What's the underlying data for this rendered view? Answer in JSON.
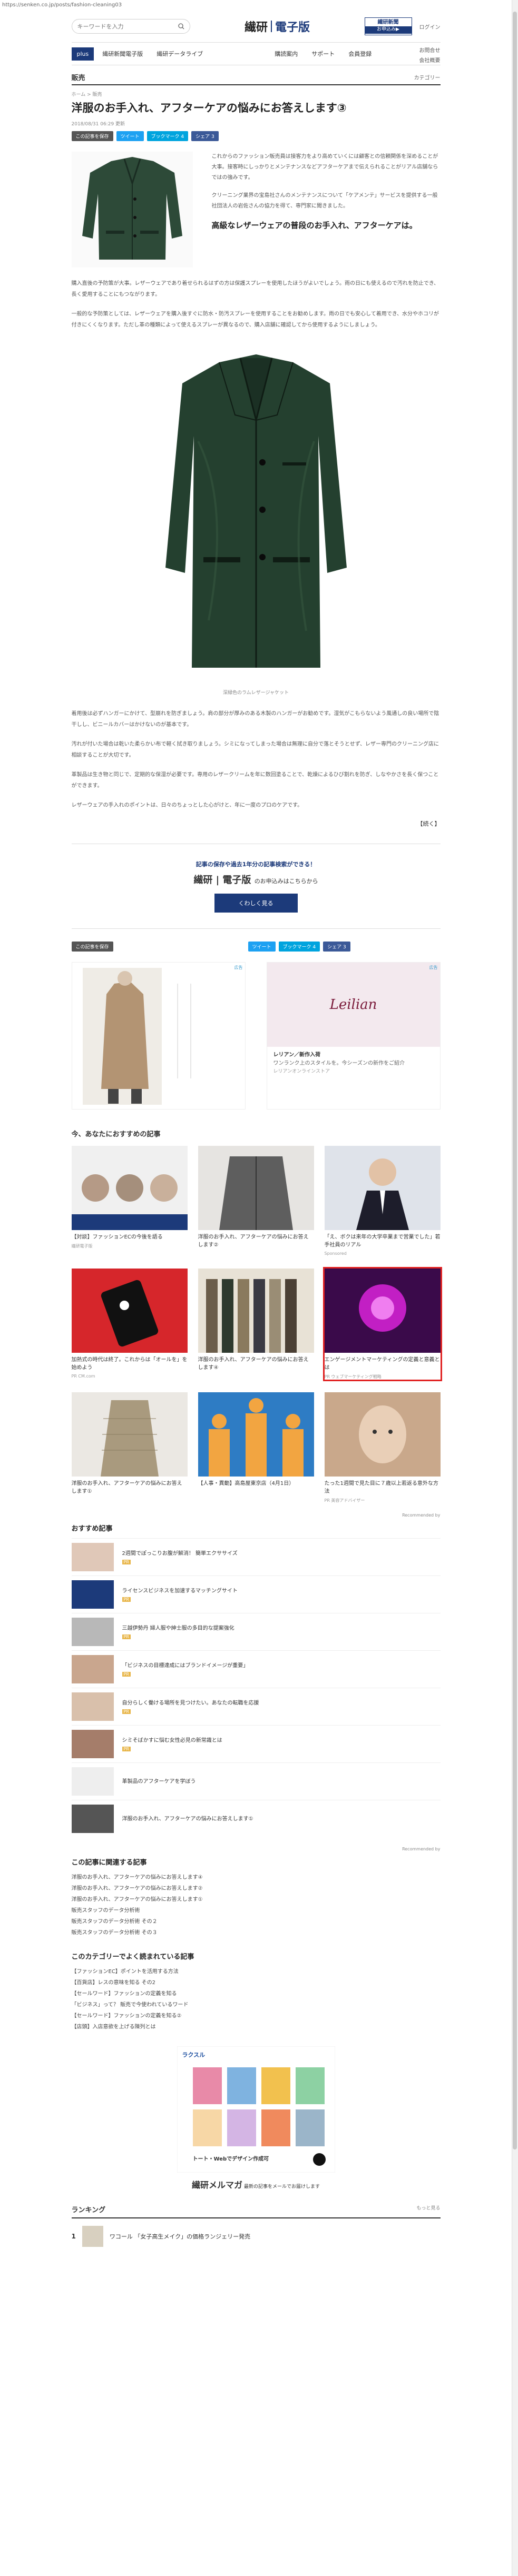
{
  "url": "https://senken.co.jp/posts/fashion-cleaning03",
  "header": {
    "search_placeholder": "キーワードを入力",
    "logo_main": "繊研",
    "logo_sub": "電子版",
    "subscribe_title": "繊研新聞",
    "subscribe_sub": "電子版",
    "subscribe_btn": "お申込み▶",
    "login": "ログイン"
  },
  "nav": {
    "plus": "plus",
    "items": [
      "繊研新聞電子版",
      "繊研データライブ",
      "購読案内",
      "サポート",
      "会員登録"
    ],
    "right_top": "お問合せ",
    "right_bottom": "会社概要"
  },
  "section": {
    "label": "販売",
    "menu": "カテゴリー"
  },
  "article": {
    "breadcrumb": "ホーム > 販売",
    "title": "洋服のお手入れ、アフターケアの悩みにお答えします③",
    "date": "2018/08/31 06:29 更新",
    "share": [
      "この記事を保存",
      "ツイート",
      "ブックマーク 4",
      "シェア 3"
    ],
    "intro_p1": "これからのファッション販売員は接客力をより高めていくには顧客との信頼関係を深めることが大事。接客時にしっかりとメンテナンスなどアフターケアまで伝えられることがリアル店舗ならではの強みです。",
    "intro_p2": "クリーニング業界の宝島社さんのメンテナンスについて「ケアメンテ」サービスを提供する一般社団法人の岩佐さんの協力を得て、専門家に聞きました。",
    "heading": "高級なレザーウェアの普段のお手入れ、アフターケアは。",
    "p1": "購入直後の予防策が大事。レザーウェアであり着せられるはずの方は保護スプレーを使用したほうがよいでしょう。雨の日にも使えるので汚れを防止でき、長く愛用することにもつながります。",
    "p2": "一般的な予防策としては、レザーウェアを購入後すぐに防水・防汚スプレーを使用することをお勧めします。雨の日でも安心して着用でき、水分やホコリが付きにくくなります。ただし革の種類によって使えるスプレーが異なるので、購入店舗に確認してから使用するようにしましょう。",
    "photo_caption": "深緑色のラムレザージャケット",
    "p3": "着用後は必ずハンガーにかけて、型崩れを防ぎましょう。肩の部分が厚みのある木製のハンガーがお勧めです。湿気がこもらないよう風通しの良い場所で陰干しし、ビニールカバーはかけないのが基本です。",
    "p4": "汚れが付いた場合は乾いた柔らかい布で軽く拭き取りましょう。シミになってしまった場合は無理に自分で落とそうとせず、レザー専門のクリーニング店に相談することが大切です。",
    "p5": "革製品は生き物と同じで、定期的な保湿が必要です。専用のレザークリームを年に数回塗ることで、乾燥によるひび割れを防ぎ、しなやかさを長く保つことができます。",
    "p6": "レザーウェアの手入れのポイントは、日々のちょっとした心がけと、年に一度のプロのケアです。",
    "next": "【続く】"
  },
  "promo": {
    "lead": "記事の保存や過去1年分の記事検索ができる！",
    "logo": "繊研 | 電子版",
    "suffix": "のお申込みはこちらから",
    "button": "くわしく見る"
  },
  "share2": [
    "この記事を保存",
    "ツイート",
    "ブックマーク 4",
    "シェア 3"
  ],
  "ads": [
    {
      "label": "広告"
    },
    {
      "label": "広告",
      "brand": "Leilian",
      "t1": "レリアン／新作入荷",
      "t2": "ワンランク上のスタイルを。今シーズンの新作をご紹介",
      "t3": "レリアンオンラインストア"
    }
  ],
  "recommend": {
    "title": "今、あなたにおすすめの記事",
    "cards": [
      {
        "title": "【対談】ファッションECの今後を語る",
        "src": "繊研電子版"
      },
      {
        "title": "洋服のお手入れ、アフターケアの悩みにお答えします②",
        "src": ""
      },
      {
        "title": "「え、ボクは来年の大学卒業まで営業でした」若手社員のリアル",
        "src": "Sponsored"
      },
      {
        "title": "加熱式の時代は終了。これからは「オールを」を始めよう",
        "src": "PR CM.com"
      },
      {
        "title": "洋服のお手入れ、アフターケアの悩みにお答えします④",
        "src": ""
      },
      {
        "title": "エンゲージメントマーケティングの定義と意義とは",
        "src": "PR ウェブマーケティング戦略"
      },
      {
        "title": "洋服のお手入れ、アフターケアの悩みにお答えします①",
        "src": ""
      },
      {
        "title": "【人事・異動】高島屋東京店（4月1日）",
        "src": ""
      },
      {
        "title": "たった1週間で見た目に７歳以上若返る意外な方法",
        "src": "PR 美容アドバイザー"
      }
    ],
    "by": "Recommended by"
  },
  "osusume": {
    "title": "おすすめ記事",
    "items": [
      {
        "t": "2週間でぽっこりお腹が解消！ 簡単エクササイズ",
        "s": "PR"
      },
      {
        "t": "ライセンスビジネスを加速するマッチングサイト",
        "s": "PR"
      },
      {
        "t": "三越伊勢丹 婦人服や紳士服の多目的な提案強化",
        "s": "PR"
      },
      {
        "t": "「ビジネスの目標達成にはブランドイメージが重要」",
        "s": "PR"
      },
      {
        "t": "自分らしく働ける場所を見つけたい。あなたの転職を応援",
        "s": "PR"
      },
      {
        "t": "シミそばかすに悩む女性必見の新常識とは",
        "s": "PR"
      },
      {
        "t": "革製品のアフターケアを学ぼう",
        "s": ""
      },
      {
        "t": "洋服のお手入れ、アフターケアの悩みにお答えします①",
        "s": ""
      }
    ],
    "by": "Recommended by"
  },
  "related": {
    "title": "この記事に関連する記事",
    "links": [
      "洋服のお手入れ、アフターケアの悩みにお答えします④",
      "洋服のお手入れ、アフターケアの悩みにお答えします②",
      "洋服のお手入れ、アフターケアの悩みにお答えします①",
      "販売スタッフのデータ分析術",
      "販売スタッフのデータ分析術 その２",
      "販売スタッフのデータ分析術 その３"
    ]
  },
  "popular": {
    "title": "このカテゴリーでよく読まれている記事",
    "links": [
      "【ファッションEC】ポイントを活用する方法",
      "【百貨店】レスの意味を知る その2",
      "【セールワード】ファッションの定義を知る",
      "「ビジネス」って？ 販売で今使われているワード",
      "【セールワード】ファッションの定義を知る②",
      "【店頭】入店意欲を上げる陳列とは"
    ]
  },
  "bottom_ad": {
    "brand": "ラクスル",
    "text": "トート・Webでデザイン作成可"
  },
  "mailmag": {
    "title": "繊研メルマガ",
    "desc": "最新の記事をメールでお届けします"
  },
  "ranking": {
    "title": "ランキング",
    "more": "もっと見る",
    "first": {
      "num": "1",
      "t": "ワコール 「女子高生メイク」の価格ランジェリー発売"
    }
  }
}
